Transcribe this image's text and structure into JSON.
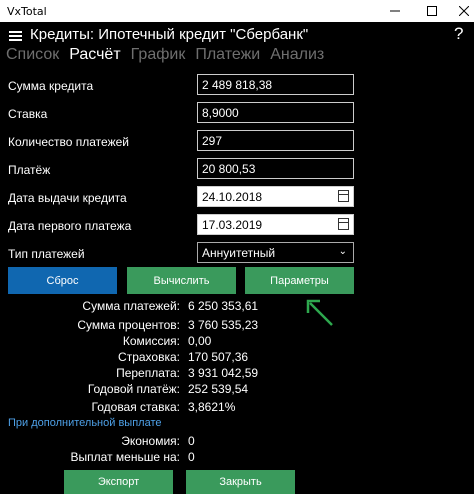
{
  "window": {
    "app_title": "VxTotal"
  },
  "header": {
    "title": "Кредиты: Ипотечный кредит \"Сбербанк\"",
    "help": "?"
  },
  "tabs": [
    {
      "label": "Список",
      "active": false
    },
    {
      "label": "Расчёт",
      "active": true
    },
    {
      "label": "График",
      "active": false
    },
    {
      "label": "Платежи",
      "active": false
    },
    {
      "label": "Анализ",
      "active": false
    }
  ],
  "form": {
    "loan_amount": {
      "label": "Сумма кредита",
      "value": "2 489 818,38"
    },
    "rate": {
      "label": "Ставка",
      "value": "8,9000"
    },
    "payments_count": {
      "label": "Количество платежей",
      "value": "297"
    },
    "payment": {
      "label": "Платёж",
      "value": "20 800,53"
    },
    "issue_date": {
      "label": "Дата выдачи кредита",
      "value": "24.10.2018"
    },
    "first_payment_date": {
      "label": "Дата первого платежа",
      "value": "17.03.2019"
    },
    "payment_type": {
      "label": "Тип платежей",
      "value": "Аннуитетный"
    }
  },
  "buttons": {
    "reset": "Сброс",
    "calculate": "Вычислить",
    "params": "Параметры",
    "export": "Экспорт",
    "close": "Закрыть"
  },
  "results": [
    {
      "label": "Сумма платежей:",
      "value": "6 250 353,61"
    },
    {
      "label": "Сумма процентов:",
      "value": "3 760 535,23"
    },
    {
      "label": "Комиссия:",
      "value": "0,00"
    },
    {
      "label": "Страховка:",
      "value": "170 507,36"
    },
    {
      "label": "Переплата:",
      "value": "3 931 042,59"
    },
    {
      "label": "Годовой платёж:",
      "value": "252 539,54"
    },
    {
      "label": "Годовая ставка:",
      "value": "3,8621%"
    }
  ],
  "extra": {
    "link": "При дополнительной выплате",
    "economy": {
      "label": "Экономия:",
      "value": "0"
    },
    "smaller_payment": {
      "label": "Выплат меньше на:",
      "value": "0"
    }
  },
  "colors": {
    "accent_blue": "#1067b0",
    "accent_green": "#3a9a5c",
    "link": "#4ea1e8"
  }
}
